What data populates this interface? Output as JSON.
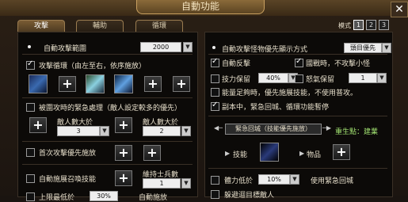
{
  "window": {
    "title": "自動功能",
    "close": "✕"
  },
  "tabs": [
    {
      "label": "攻擊"
    },
    {
      "label": "輔助"
    },
    {
      "label": "循環"
    }
  ],
  "mode": {
    "label": "模式",
    "options": [
      "1",
      "2",
      "3"
    ]
  },
  "left": {
    "attack_range_label": "自動攻擊範圍",
    "attack_range_value": "2000",
    "cycle_label": "攻擊循環（由左至右，依序施放）",
    "emergency_label": "被圍攻時的緊急處理（敵人設定較多的優先）",
    "enemy_count_label": "敵人數大於",
    "enemy_count_1": "3",
    "enemy_count_2": "2",
    "first_attack_label": "首次攻擊優先施放",
    "auto_skill_label": "自動施展召喚技能",
    "maintain_label": "維持士兵數",
    "maintain_value": "1",
    "cut_label": "上限最低於",
    "cut_value": "30%",
    "cut_tail": "自動施放"
  },
  "right": {
    "priority_label": "自動攻擊怪物優先顯示方式",
    "priority_value": "頭目優先",
    "auto_counter": "自動反擊",
    "defend_mode": "國戰時，不攻擊小怪",
    "skill_keep": "技力保留",
    "skill_keep_value": "40%",
    "rage_keep": "怒氣保留",
    "rage_keep_value": "1",
    "energy_label": "能量足夠時，優先施展技能，不使用普攻。",
    "dungeon_label": "副本中，緊急回城、循環功能暫停",
    "banner": "緊急回城（技能優先施放）",
    "respawn_label": "重生點：建業",
    "skill_label": "技能",
    "item_label": "物品",
    "hp_label": "體力低於",
    "hp_value": "10%",
    "hp_tail": "使用緊急回城",
    "avoid_label": "躲避迴目標敵人"
  }
}
